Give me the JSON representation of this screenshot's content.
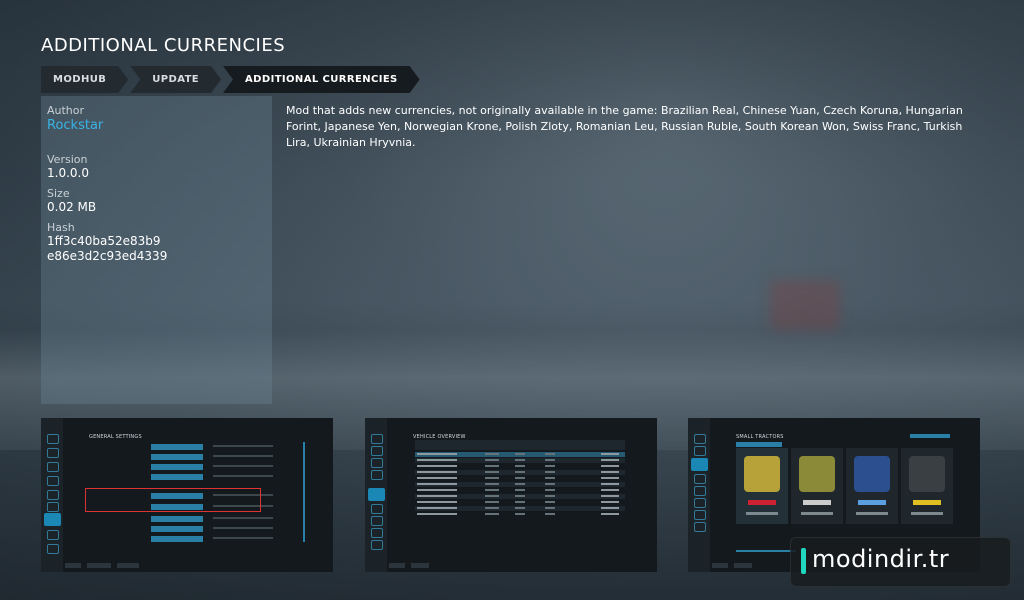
{
  "page": {
    "title": "ADDITIONAL CURRENCIES"
  },
  "breadcrumb": [
    "MODHUB",
    "UPDATE",
    "ADDITIONAL CURRENCIES"
  ],
  "info": {
    "author_label": "Author",
    "author": "Rockstar",
    "version_label": "Version",
    "version": "1.0.0.0",
    "size_label": "Size",
    "size": "0.02 MB",
    "hash_label": "Hash",
    "hash_line1": "1ff3c40ba52e83b9",
    "hash_line2": "e86e3d2c93ed4339"
  },
  "description": "Mod that adds new currencies, not originally available in the game: Brazilian Real, Chinese Yuan, Czech Koruna, Hungarian Forint, Japanese Yen, Norwegian Krone, Polish Zloty, Romanian Leu, Russian Ruble, South Korean Won, Swiss Franc, Turkish Lira, Ukrainian Hryvnia.",
  "screenshots": {
    "shot1_title": "GENERAL SETTINGS",
    "shot2_title": "VEHICLE OVERVIEW",
    "shot3_title": "SMALL TRACTORS"
  },
  "watermark": "modindir.tr",
  "colors": {
    "accent": "#39b3e6",
    "panel": "#6e8796",
    "crumb_bg": "#232b31",
    "highlight_box": "#d33"
  }
}
